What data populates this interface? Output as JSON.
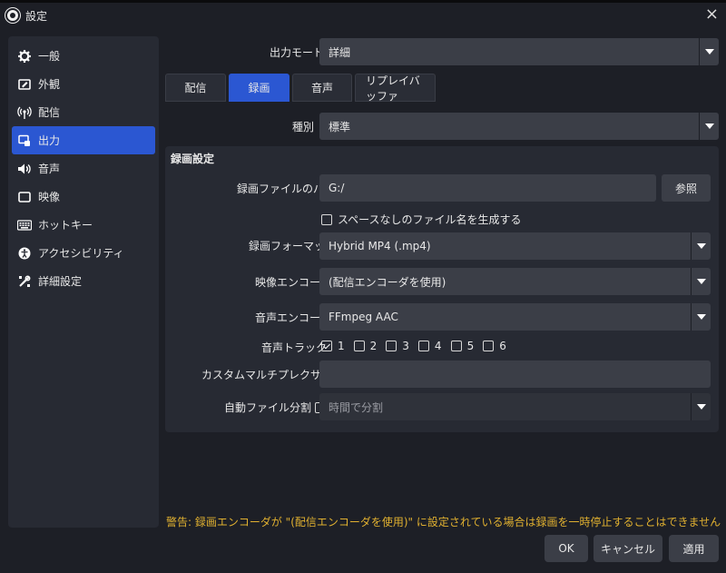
{
  "window": {
    "title": "設定",
    "close_label": "×"
  },
  "sidebar": {
    "items": [
      {
        "label": "一般",
        "icon": "gear-icon"
      },
      {
        "label": "外観",
        "icon": "appearance-icon"
      },
      {
        "label": "配信",
        "icon": "broadcast-icon"
      },
      {
        "label": "出力",
        "icon": "output-icon",
        "active": true
      },
      {
        "label": "音声",
        "icon": "speaker-icon"
      },
      {
        "label": "映像",
        "icon": "monitor-icon"
      },
      {
        "label": "ホットキー",
        "icon": "keyboard-icon"
      },
      {
        "label": "アクセシビリティ",
        "icon": "accessibility-icon"
      },
      {
        "label": "詳細設定",
        "icon": "tools-icon"
      }
    ]
  },
  "output_mode": {
    "label": "出力モード",
    "value": "詳細"
  },
  "tabs": [
    {
      "label": "配信"
    },
    {
      "label": "録画",
      "active": true
    },
    {
      "label": "音声"
    },
    {
      "label": "リプレイバッファ"
    }
  ],
  "type": {
    "label": "種別",
    "value": "標準"
  },
  "recording": {
    "group_title": "録画設定",
    "path_label": "録画ファイルのパス",
    "path_value": "G:/",
    "browse_label": "参照",
    "no_space_label": "スペースなしのファイル名を生成する",
    "format_label": "録画フォーマット",
    "format_value": "Hybrid MP4 (.mp4)",
    "video_encoder_label": "映像エンコーダ",
    "video_encoder_value": "(配信エンコーダを使用)",
    "audio_encoder_label": "音声エンコーダ",
    "audio_encoder_value": "FFmpeg AAC",
    "audio_track_label": "音声トラック",
    "tracks": [
      {
        "label": "1",
        "checked": true
      },
      {
        "label": "2",
        "checked": false
      },
      {
        "label": "3",
        "checked": false
      },
      {
        "label": "4",
        "checked": false
      },
      {
        "label": "5",
        "checked": false
      },
      {
        "label": "6",
        "checked": false
      }
    ],
    "muxer_label": "カスタムマルチプレクサ設定",
    "muxer_value": "",
    "auto_split_label": "自動ファイル分割",
    "auto_split_value": "時間で分割"
  },
  "warning": "警告: 録画エンコーダが \"(配信エンコーダを使用)\" に設定されている場合は録画を一時停止することはできません",
  "footer": {
    "ok": "OK",
    "cancel": "キャンセル",
    "apply": "適用"
  },
  "colors": {
    "accent": "#2b57d2",
    "warning": "#e0b030",
    "background": "#1d1f26",
    "panel": "#272a33"
  }
}
